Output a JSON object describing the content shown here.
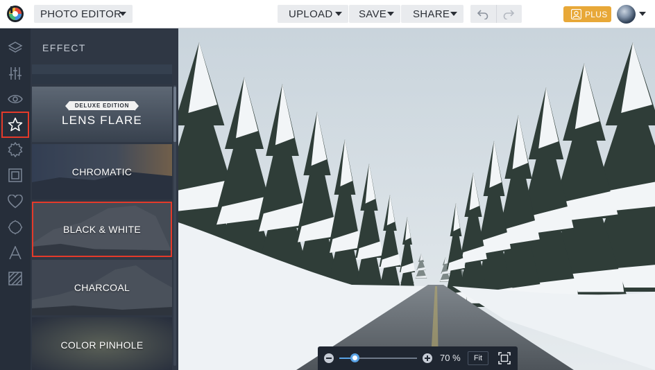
{
  "topbar": {
    "editor_label": "PHOTO EDITOR",
    "upload_label": "UPLOAD",
    "save_label": "SAVE",
    "share_label": "SHARE",
    "plus_label": "PLUS",
    "undo_icon": "undo-icon",
    "redo_icon": "redo-icon"
  },
  "rail": {
    "icons": [
      "layers-icon",
      "adjust-sliders-icon",
      "eye-icon",
      "star-icon",
      "badge-icon",
      "frame-icon",
      "heart-icon",
      "sticker-icon",
      "text-icon",
      "texture-icon"
    ],
    "selected": "star-icon"
  },
  "panel": {
    "title": "EFFECT",
    "badge": "DELUXE EDITION",
    "items": [
      {
        "label": "LENS FLARE",
        "deluxe": true
      },
      {
        "label": "CHROMATIC"
      },
      {
        "label": "BLACK & WHITE",
        "selected": true
      },
      {
        "label": "CHARCOAL"
      },
      {
        "label": "COLOR PINHOLE"
      }
    ]
  },
  "zoom": {
    "value_text": "70 %",
    "level": 0.2,
    "fit_label": "Fit"
  },
  "colors": {
    "accent": "#e8a838",
    "highlight": "#e53a2a",
    "slider": "#5aa3e6",
    "panel_bg": "#2f3744",
    "rail_bg": "#262e3a"
  }
}
